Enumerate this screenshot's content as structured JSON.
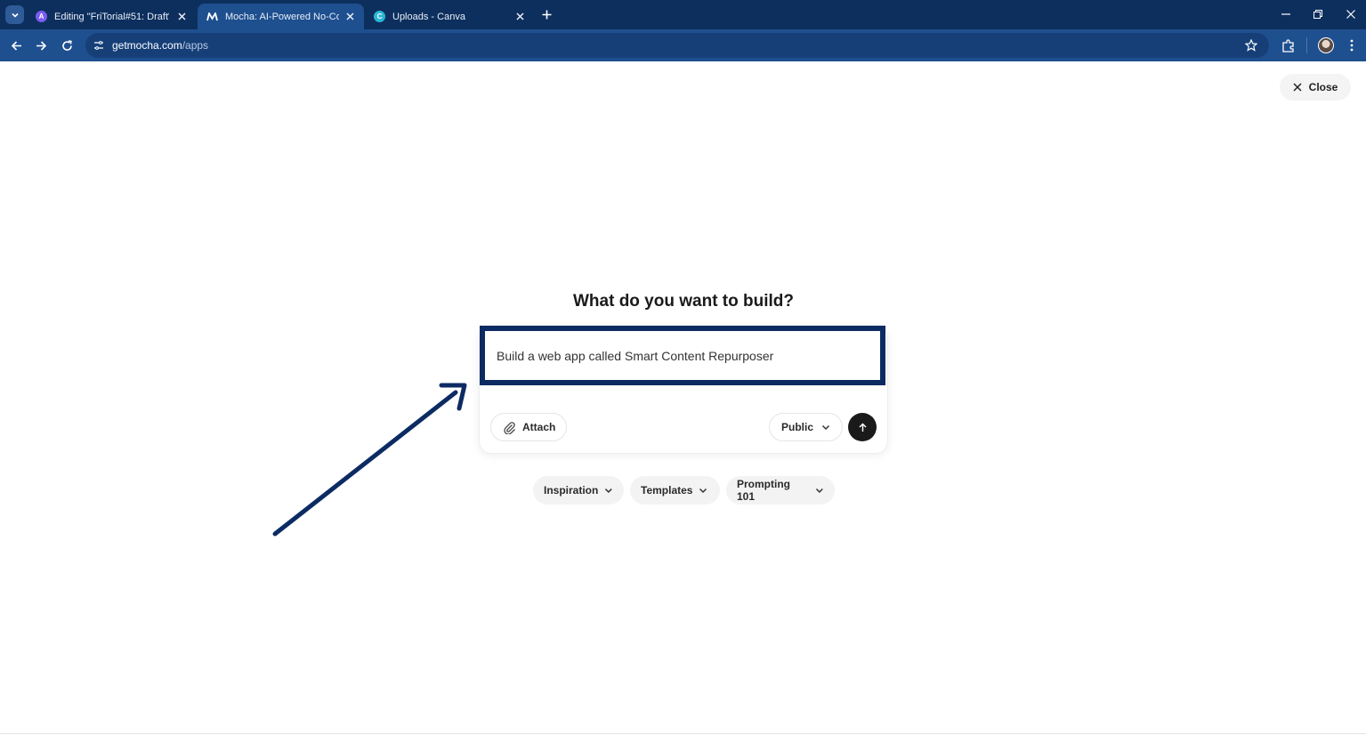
{
  "browser": {
    "tabs": [
      {
        "title": "Editing \"FriTorial#51: Draft\"",
        "favicon": "app-purple-icon",
        "color": "#7b5cf0",
        "active": false
      },
      {
        "title": "Mocha: AI-Powered No-Code A",
        "favicon": "mocha-logo-icon",
        "color": "#0d2f5e",
        "active": true
      },
      {
        "title": "Uploads - Canva",
        "favicon": "canva-logo-icon",
        "color": "#2bb6d6",
        "active": false
      }
    ],
    "url_host": "getmocha.com",
    "url_path": "/apps",
    "icons": [
      "tab-search-icon",
      "back-arrow-icon",
      "forward-arrow-icon",
      "reload-icon",
      "site-info-icon",
      "bookmark-star-icon",
      "extensions-icon",
      "profile-avatar",
      "menu-dots-icon",
      "minimize-icon",
      "restore-icon",
      "window-close-icon",
      "new-tab-plus-icon"
    ]
  },
  "page": {
    "close_label": "Close",
    "headline": "What do you want to build?",
    "prompt_value": "Build a web app called Smart Content Repurposer",
    "attach_label": "Attach",
    "visibility_label": "Public",
    "chips": [
      "Inspiration",
      "Templates",
      "Prompting 101"
    ]
  },
  "colors": {
    "chrome_dark": "#0d2f5e",
    "chrome_toolbar": "#1e4f8f",
    "highlight_border": "#0d2b63",
    "annotation_arrow": "#0d2b63",
    "send_button": "#1a1a1a"
  }
}
